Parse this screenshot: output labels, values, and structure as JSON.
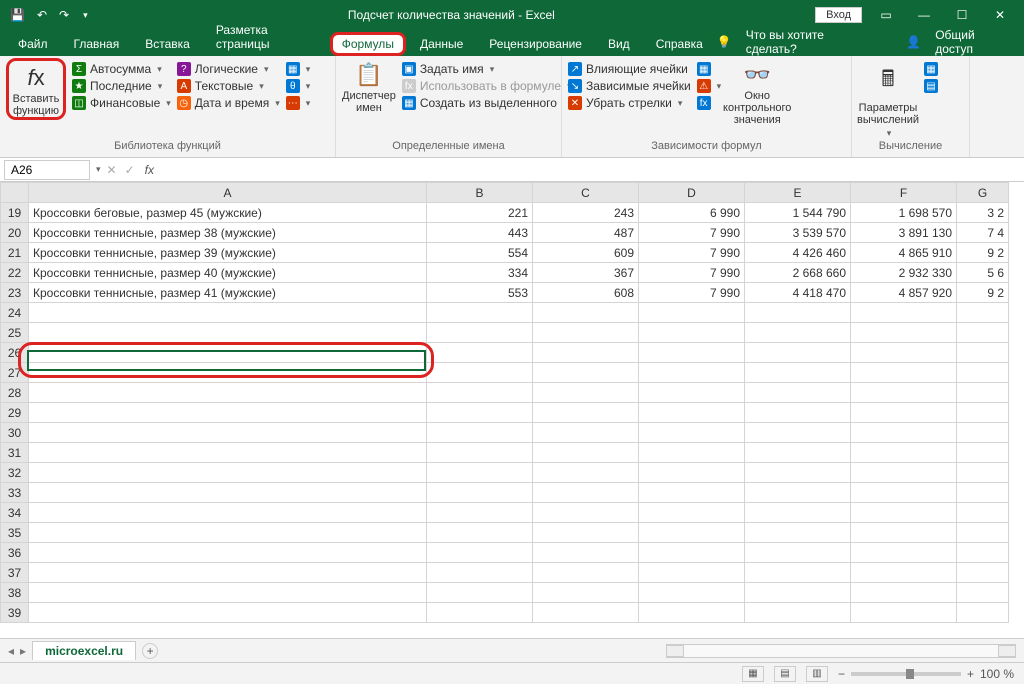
{
  "titlebar": {
    "title": "Подсчет количества значений  -  Excel",
    "login": "Вход"
  },
  "tabs": {
    "file": "Файл",
    "home": "Главная",
    "insert": "Вставка",
    "layout": "Разметка страницы",
    "formulas": "Формулы",
    "data": "Данные",
    "review": "Рецензирование",
    "view": "Вид",
    "help": "Справка",
    "telme": "Что вы хотите сделать?",
    "share": "Общий доступ"
  },
  "ribbon": {
    "insertfn": "Вставить\nфункцию",
    "lib": {
      "autosum": "Автосумма",
      "recent": "Последние",
      "financial": "Финансовые",
      "logical": "Логические",
      "text": "Текстовые",
      "datetime": "Дата и время",
      "group": "Библиотека функций"
    },
    "names": {
      "mgr": "Диспетчер\nимен",
      "define": "Задать имя",
      "usein": "Использовать в формуле",
      "fromsel": "Создать из выделенного",
      "group": "Определенные имена"
    },
    "deps": {
      "prec": "Влияющие ячейки",
      "dep": "Зависимые ячейки",
      "remove": "Убрать стрелки",
      "watch": "Окно контрольного\nзначения",
      "group": "Зависимости формул"
    },
    "calc": {
      "opts": "Параметры\nвычислений",
      "group": "Вычисление"
    }
  },
  "namebox": "A26",
  "columns": [
    "A",
    "B",
    "C",
    "D",
    "E",
    "F",
    "G"
  ],
  "rows": [
    {
      "n": 19,
      "a": "Кроссовки беговые, размер 45 (мужские)",
      "b": "221",
      "c": "243",
      "d": "6 990",
      "e": "1 544 790",
      "f": "1 698 570",
      "g": "3 2"
    },
    {
      "n": 20,
      "a": "Кроссовки теннисные, размер 38 (мужские)",
      "b": "443",
      "c": "487",
      "d": "7 990",
      "e": "3 539 570",
      "f": "3 891 130",
      "g": "7 4"
    },
    {
      "n": 21,
      "a": "Кроссовки теннисные, размер 39 (мужские)",
      "b": "554",
      "c": "609",
      "d": "7 990",
      "e": "4 426 460",
      "f": "4 865 910",
      "g": "9 2"
    },
    {
      "n": 22,
      "a": "Кроссовки теннисные, размер 40 (мужские)",
      "b": "334",
      "c": "367",
      "d": "7 990",
      "e": "2 668 660",
      "f": "2 932 330",
      "g": "5 6"
    },
    {
      "n": 23,
      "a": "Кроссовки теннисные, размер 41 (мужские)",
      "b": "553",
      "c": "608",
      "d": "7 990",
      "e": "4 418 470",
      "f": "4 857 920",
      "g": "9 2"
    },
    {
      "n": 24
    },
    {
      "n": 25
    },
    {
      "n": 26
    },
    {
      "n": 27
    },
    {
      "n": 28
    },
    {
      "n": 29
    },
    {
      "n": 30
    },
    {
      "n": 31
    },
    {
      "n": 32
    },
    {
      "n": 33
    },
    {
      "n": 34
    },
    {
      "n": 35
    },
    {
      "n": 36
    },
    {
      "n": 37
    },
    {
      "n": 38
    },
    {
      "n": 39
    }
  ],
  "sheetTab": "microexcel.ru",
  "zoom": "100 %"
}
